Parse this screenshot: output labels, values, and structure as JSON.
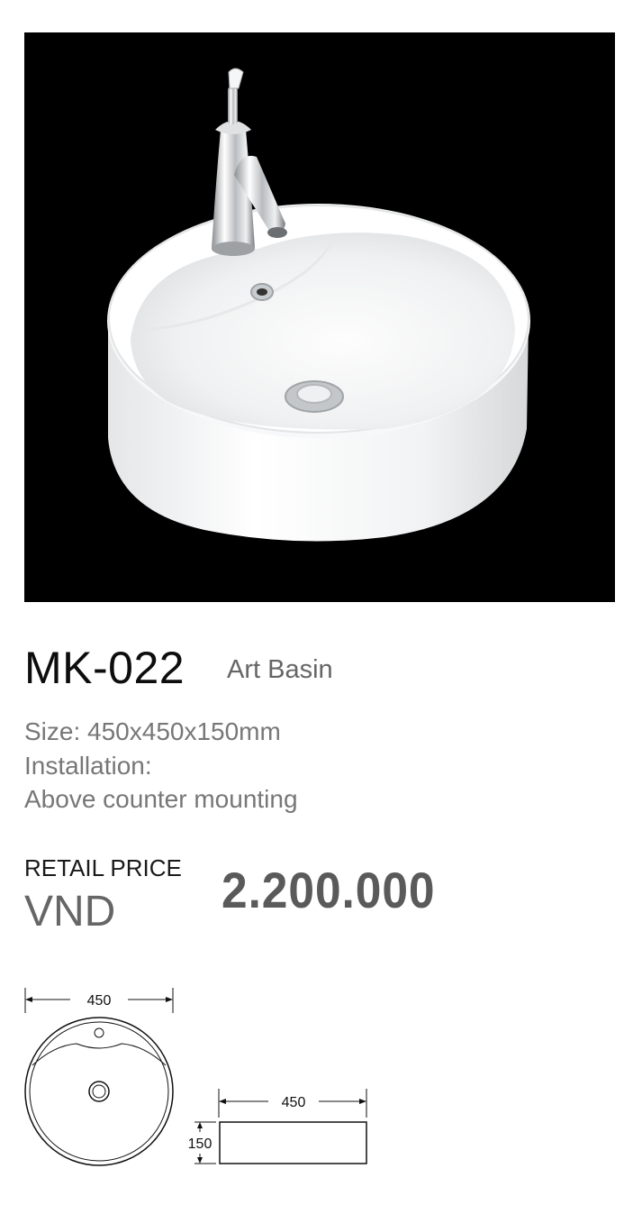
{
  "product": {
    "model": "MK-022",
    "category": "Art Basin",
    "size": "Size: 450x450x150mm",
    "installation_label": "Installation:",
    "installation_value": "Above counter mounting"
  },
  "pricing": {
    "label": "RETAIL PRICE",
    "currency": "VND",
    "amount": "2.200.000"
  },
  "diagram": {
    "top_view_width": "450",
    "side_view_width": "450",
    "side_view_height": "150"
  },
  "photo": {
    "background": "#000000",
    "icons": [
      "faucet-icon",
      "basin-icon",
      "drain-icon",
      "overflow-icon"
    ]
  }
}
